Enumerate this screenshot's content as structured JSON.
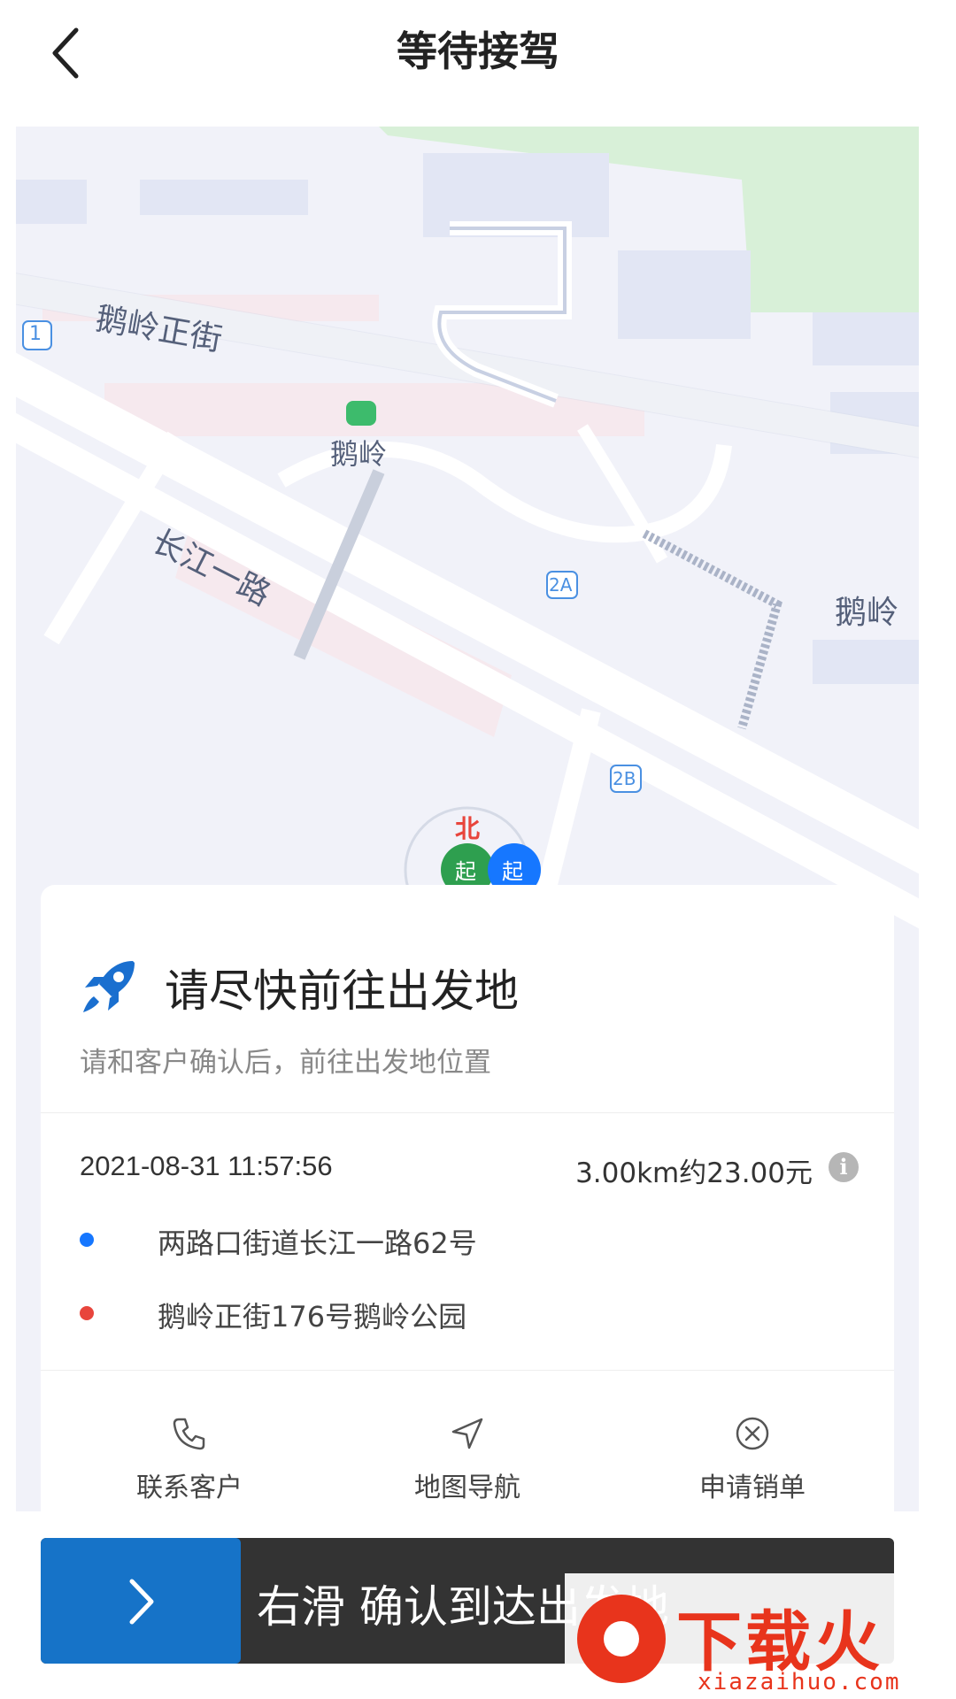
{
  "header": {
    "title": "等待接驾"
  },
  "map": {
    "street_labels": [
      "鹅岭正街",
      "长江一路",
      "鹅岭"
    ],
    "poi_label": "鹅岭",
    "markers": [
      "北",
      "起",
      "起"
    ],
    "exit_badges": [
      "1",
      "2A",
      "2B"
    ]
  },
  "card": {
    "title": "请尽快前往出发地",
    "subtitle": "请和客户确认后，前往出发地位置",
    "time": "2021-08-31  11:57:56",
    "distance_fare": "3.00km约23.00元",
    "origin_address": "两路口街道长江一路62号",
    "destination_address": "鹅岭正街176号鹅岭公园",
    "origin_color": "#1677ff",
    "destination_color": "#e8453c",
    "actions": [
      {
        "label": "联系客户",
        "icon": "phone-icon"
      },
      {
        "label": "地图导航",
        "icon": "navigation-arrow-icon"
      },
      {
        "label": "申请销单",
        "icon": "close-circle-icon"
      }
    ]
  },
  "slider": {
    "text": "右滑  确认到达出发地"
  },
  "watermark": {
    "text": "下载火",
    "url": "xiazaihuo.com"
  }
}
